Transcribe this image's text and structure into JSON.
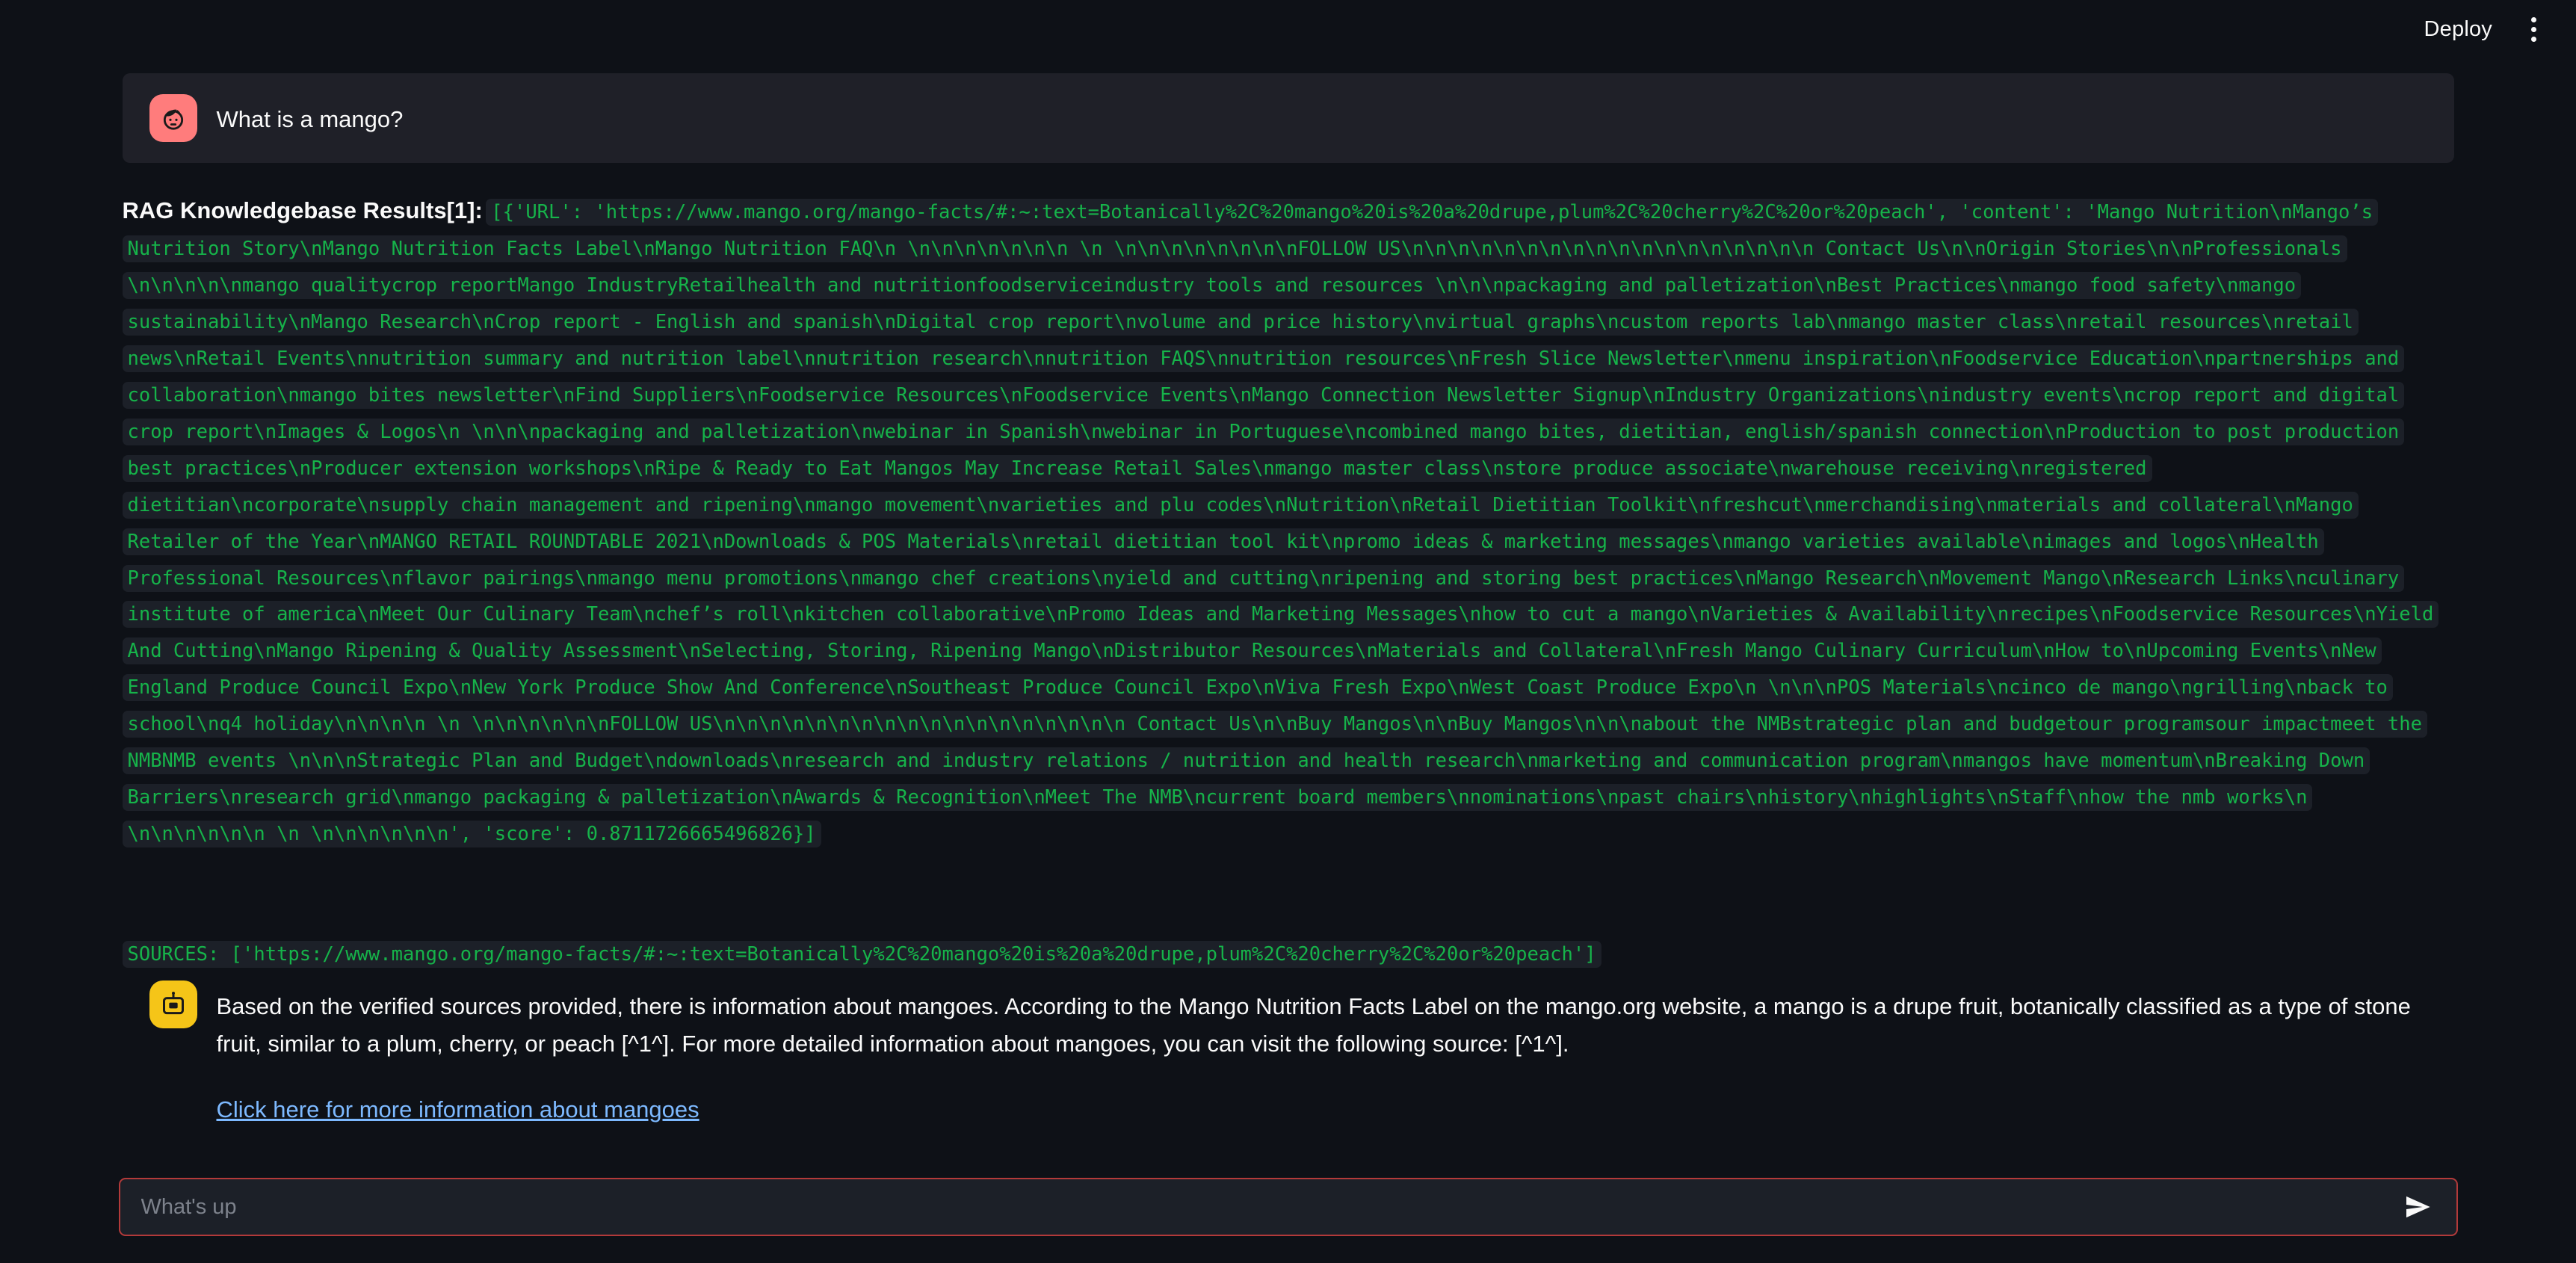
{
  "header": {
    "deploy_label": "Deploy",
    "menu_icon": "more-vertical-icon"
  },
  "user_message": {
    "avatar_icon": "user-avatar-icon",
    "text": "What is a mango?"
  },
  "rag": {
    "label": "RAG Knowledgebase Results[1]:",
    "payload": "[{'URL': 'https://www.mango.org/mango-facts/#:~:text=Botanically%2C%20mango%20is%20a%20drupe,plum%2C%20cherry%2C%20or%20peach', 'content': 'Mango Nutrition\\nMango’s Nutrition Story\\nMango Nutrition Facts Label\\nMango Nutrition FAQ\\n \\n\\n\\n\\n\\n\\n\\n \\n \\n\\n\\n\\n\\n\\n\\n\\nFOLLOW US\\n\\n\\n\\n\\n\\n\\n\\n\\n\\n\\n\\n\\n\\n\\n\\n\\n\\n Contact Us\\n\\nOrigin Stories\\n\\nProfessionals \\n\\n\\n\\n\\nmango qualitycrop reportMango IndustryRetailhealth and nutritionfoodserviceindustry tools and resources \\n\\n\\npackaging and palletization\\nBest Practices\\nmango food safety\\nmango sustainability\\nMango Research\\nCrop report - English and spanish\\nDigital crop report\\nvolume and price history\\nvirtual graphs\\ncustom reports lab\\nmango master class\\nretail resources\\nretail news\\nRetail Events\\nnutrition summary and nutrition label\\nnutrition research\\nnutrition FAQS\\nnutrition resources\\nFresh Slice Newsletter\\nmenu inspiration\\nFoodservice Education\\npartnerships and collaboration\\nmango bites newsletter\\nFind Suppliers\\nFoodservice Resources\\nFoodservice Events\\nMango Connection Newsletter Signup\\nIndustry Organizations\\nindustry events\\ncrop report and digital crop report\\nImages & Logos\\n \\n\\n\\npackaging and palletization\\nwebinar in Spanish\\nwebinar in Portuguese\\ncombined mango bites, dietitian, english/spanish connection\\nProduction to post production best practices\\nProducer extension workshops\\nRipe & Ready to Eat Mangos May Increase Retail Sales\\nmango master class\\nstore produce associate\\nwarehouse receiving\\nregistered dietitian\\ncorporate\\nsupply chain management and ripening\\nmango movement\\nvarieties and plu codes\\nNutrition\\nRetail Dietitian Toolkit\\nfreshcut\\nmerchandising\\nmaterials and collateral\\nMango Retailer of the Year\\nMANGO RETAIL ROUNDTABLE 2021\\nDownloads & POS Materials\\nretail dietitian tool kit\\npromo ideas & marketing messages\\nmango varieties available\\nimages and logos\\nHealth Professional Resources\\nflavor pairings\\nmango menu promotions\\nmango chef creations\\nyield and cutting\\nripening and storing best practices\\nMango Research\\nMovement Mango\\nResearch Links\\nculinary institute of america\\nMeet Our Culinary Team\\nchef’s roll\\nkitchen collaborative\\nPromo Ideas and Marketing Messages\\nhow to cut a mango\\nVarieties & Availability\\nrecipes\\nFoodservice Resources\\nYield And Cutting\\nMango Ripening & Quality Assessment\\nSelecting, Storing, Ripening Mango\\nDistributor Resources\\nMaterials and Collateral\\nFresh Mango Culinary Curriculum\\nHow to\\nUpcoming Events\\nNew England Produce Council Expo\\nNew York Produce Show And Conference\\nSoutheast Produce Council Expo\\nViva Fresh Expo\\nWest Coast Produce Expo\\n \\n\\n\\nPOS Materials\\ncinco de mango\\ngrilling\\nback to school\\nq4 holiday\\n\\n\\n\\n \\n \\n\\n\\n\\n\\n\\nFOLLOW US\\n\\n\\n\\n\\n\\n\\n\\n\\n\\n\\n\\n\\n\\n\\n\\n\\n\\n Contact Us\\n\\nBuy Mangos\\n\\nBuy Mangos\\n\\n\\nabout the NMBstrategic plan and budgetour programsour impactmeet the NMBNMB events \\n\\n\\nStrategic Plan and Budget\\ndownloads\\nresearch and industry relations / nutrition and health research\\nmarketing and communication program\\nmangos have momentum\\nBreaking Down Barriers\\nresearch grid\\nmango packaging & palletization\\nAwards & Recognition\\nMeet The NMB\\ncurrent board members\\nnominations\\npast chairs\\nhistory\\nhighlights\\nStaff\\nhow the nmb works\\n \\n\\n\\n\\n\\n\\n \\n \\n\\n\\n\\n\\n\\n', 'score': 0.8711726665496826}]"
  },
  "sources": {
    "text": "SOURCES: ['https://www.mango.org/mango-facts/#:~:text=Botanically%2C%20mango%20is%20a%20drupe,plum%2C%20cherry%2C%20or%20peach']"
  },
  "assistant_message": {
    "avatar_icon": "assistant-avatar-icon",
    "text": "Based on the verified sources provided, there is information about mangoes. According to the Mango Nutrition Facts Label on the mango.org website, a mango is a drupe fruit, botanically classified as a type of stone fruit, similar to a plum, cherry, or peach [^1^]. For more detailed information about mangoes, you can visit the following source: [^1^].",
    "link_text": "Click here for more information about mangoes"
  },
  "chat_input": {
    "placeholder": "What's up",
    "value": "",
    "send_icon": "send-arrow-icon"
  },
  "colors": {
    "background": "#0e1117",
    "user_bubble": "#1f2028",
    "code_background": "#1c2028",
    "code_text": "#16b34a",
    "user_avatar": "#ff7c7c",
    "assistant_avatar": "#f5c518",
    "link": "#7db9ff",
    "input_border": "#b33a3a",
    "text": "#fafafa"
  }
}
